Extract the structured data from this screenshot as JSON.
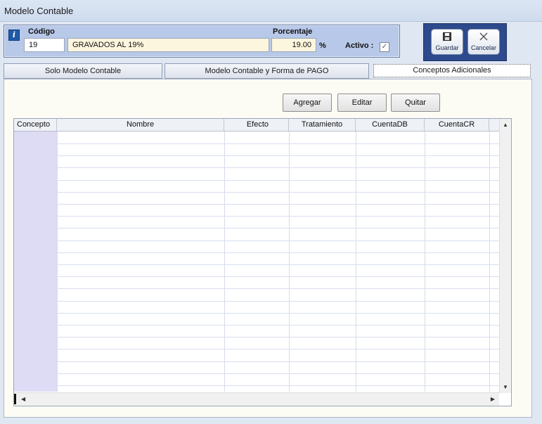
{
  "window": {
    "title": "Modelo Contable"
  },
  "header": {
    "codigo_label": "Código",
    "codigo_value": "19",
    "nombre_value": "GRAVADOS AL 19%",
    "porcentaje_label": "Porcentaje",
    "porcentaje_value": "19.00",
    "percent_symbol": "%",
    "activo_label": "Activo :",
    "activo_checked": "✓"
  },
  "toolbar": {
    "guardar_label": "Guardar",
    "cancelar_label": "Cancelar"
  },
  "tabs": [
    {
      "label": "Solo Modelo Contable"
    },
    {
      "label": "Modelo Contable y Forma de PAGO"
    },
    {
      "label": "Conceptos Adicionales"
    }
  ],
  "actions": {
    "agregar": "Agregar",
    "editar": "Editar",
    "quitar": "Quitar"
  },
  "grid": {
    "columns": [
      "Concepto",
      "Nombre",
      "Efecto",
      "Tratamiento",
      "CuentaDB",
      "CuentaCR"
    ]
  },
  "colors": {
    "header_panel": "#b8c8e8",
    "button_panel": "#2c4a8c",
    "concept_column": "#dddcf4"
  }
}
